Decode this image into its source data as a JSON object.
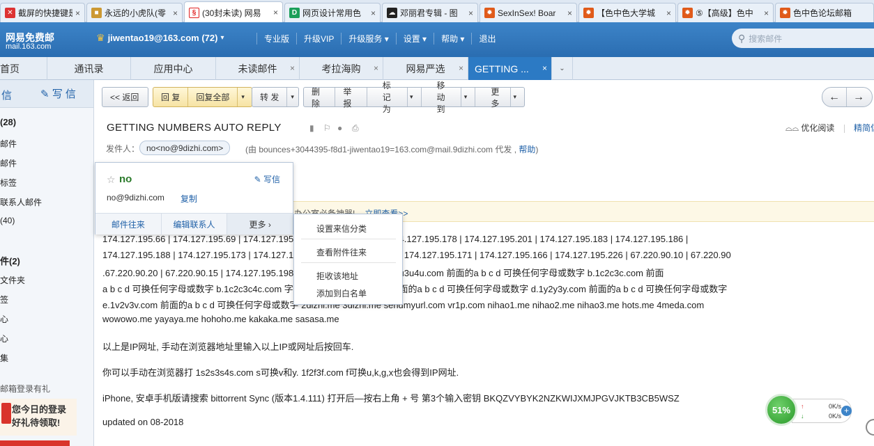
{
  "browser_tabs": [
    {
      "title": "截屏的快捷键是",
      "fav": "#d33"
    },
    {
      "title": "永远的小虎队(零",
      "fav": "#c93"
    },
    {
      "title": "(30封未读) 网易",
      "fav": "#e02020",
      "active": true
    },
    {
      "title": "网页设计常用色",
      "fav": "#1a9f5a"
    },
    {
      "title": "邓丽君专辑 - 图",
      "fav": "#222"
    },
    {
      "title": "SexInSex! Boar",
      "fav": "#e05a1a"
    },
    {
      "title": "【色中色大学城",
      "fav": "#e05a1a"
    },
    {
      "title": "⑤【高级】色中",
      "fav": "#e05a1a"
    },
    {
      "title": "色中色论坛邮箱",
      "fav": "#e05a1a"
    }
  ],
  "header": {
    "logo_title": "网易免费邮",
    "logo_domain": "mail.163.com",
    "account": "jiwentao19@163.com (72)",
    "menu": [
      "专业版",
      "升级VIP",
      "升级服务 ▾",
      "设置 ▾",
      "帮助 ▾",
      "退出"
    ],
    "search_placeholder": "搜索邮件"
  },
  "mail_tabs": [
    {
      "label": "首页"
    },
    {
      "label": "通讯录"
    },
    {
      "label": "应用中心"
    },
    {
      "label": "未读邮件",
      "close": true
    },
    {
      "label": "考拉海购",
      "close": true
    },
    {
      "label": "网易严选",
      "close": true
    },
    {
      "label": "GETTING ...",
      "close": true,
      "active": true
    }
  ],
  "sidebar": {
    "receive": "信",
    "write": "写 信",
    "inbox": "(28)",
    "items": [
      "邮件",
      "邮件",
      "标签",
      "联系人邮件",
      "(40)",
      "件(2)",
      "文件夹",
      "签",
      "心",
      "心",
      "集"
    ],
    "promo_text": "邮箱登录有礼",
    "promo_line1": "您今日的登录",
    "promo_line2": "好礼待领取!"
  },
  "toolbar": {
    "back": "<< 返回",
    "reply": "回 复",
    "reply_all": "回复全部",
    "forward": "转 发",
    "delete": "删 除",
    "report": "举 报",
    "mark_as": "标记为",
    "move_to": "移动到",
    "more": "更 多"
  },
  "mail": {
    "subject": "GETTING NUMBERS AUTO REPLY",
    "from_label": "发件人：",
    "from": "no<no@9dizhi.com>",
    "via": "(由 bounces+3044395-f8d1-jiwentao19=163.com@mail.9dizhi.com 代发 ,",
    "help": "帮助",
    "via_end": ")",
    "optimize": "优化阅读",
    "brief": "精简信"
  },
  "banner": {
    "text": "办公室必备神器!",
    "link": "立即查看>>"
  },
  "body": {
    "lines": [
      "174.127.195.66 | 174.127.195.69 | 174.127.195.72 | 174.127.195.176 | 174.127.195.178 | 174.127.195.201 | 174.127.195.183 | 174.127.195.186 |",
      "174.127.195.188 | 174.127.195.173 | 174.127.195.182 | 174.127.195.184 | 174.127.195.171 | 174.127.195.166 | 174.127.195.226 | 67.220.90.10 | 67.220.90",
      ".67.220.90.20 | 67.220.90.15 | 174.127.195.198 | 174.127.195.205 | a.1u2u3u4u.com 前面的a b c d 可换任何字母或数字 b.1c2c3c.com 前面",
      "a b c d 可换任何字母或数字 b.1c2c3c4c.com 字母或数字 c.1s2c3s.com 前面的a b c d 可换任何字母或数字 d.1y2y3y.com 前面的a b c d 可换任何字母或数字",
      "e.1v2v3v.com 前面的a b c d 可换任何字母或数字 2dizhi.me 3dizhi.me sendmyurl.com vr1p.com nihao1.me nihao2.me nihao3.me hots.me 4meda.com",
      "wowowo.me yayaya.me hohoho.me kakaka.me sasasa.me"
    ],
    "p1": "以上是IP网址, 手动在浏览器地址里输入以上IP或网址后按回车.",
    "p2": "你可以手动在浏览器打  1s2s3s4s.com s可换v和y. 1f2f3f.com f可换u,k,g,x也会得到IP网址.",
    "p3": "iPhone, 安卓手机版请搜索 bittorrent Sync (版本1.4.111) 打开后—按右上角 + 号 第3个输入密钥 BKQZVYBYK2NZKWIJXMJPGVJKTB3CB5WSZ",
    "p4": "updated on 08-2018"
  },
  "card": {
    "name": "no",
    "write": "写信",
    "email": "no@9dizhi.com",
    "copy": "复制",
    "btn1": "邮件往来",
    "btn2": "编辑联系人",
    "btn3": "更多  ›"
  },
  "menu": {
    "item1": "设置来信分类",
    "item2": "查看附件往来",
    "item3": "拒收该地址",
    "item4": "添加到白名单"
  },
  "speed": {
    "percent": "51%",
    "up": "0K/s",
    "down": "0K/s"
  },
  "colors": {
    "header_blue": "#2f74b8",
    "active_tab": "#2c7ac4",
    "link": "#2061a8"
  }
}
